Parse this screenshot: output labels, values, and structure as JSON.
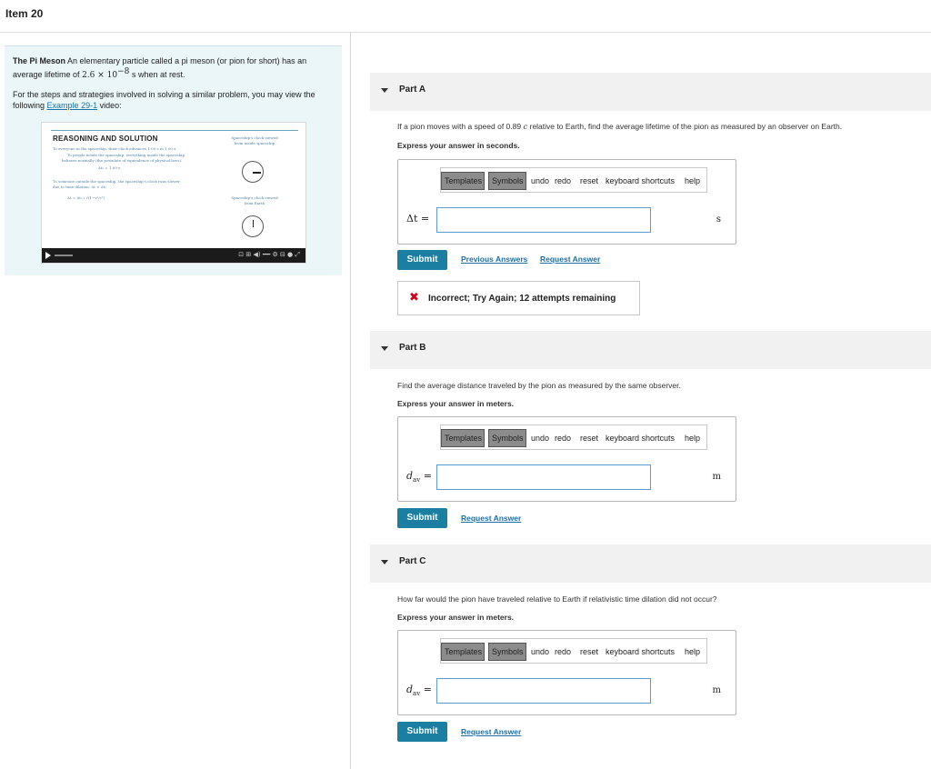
{
  "header": {
    "title": "Item 20"
  },
  "intro": {
    "title": "The Pi Meson",
    "text": "An elementary particle called a pi meson (or pion for short) has an average lifetime of",
    "value": "2.6 × 10",
    "exponent": "−8",
    "unit": "s",
    "tail": "when at rest.",
    "steps_text": "For the steps and strategies involved in solving a similar problem, you may view the following",
    "example_link": "Example 29-1",
    "steps_tail": "video:"
  },
  "video": {
    "heading": "REASONING AND SOLUTION",
    "line1": "To everyone in the spaceship, their clock advances 1.00 s in 1.00 s.",
    "line2": "To people inside the spaceship, everything inside the spaceship",
    "line3": "behaves normally (the postulate of equivalence of physical laws).",
    "line4": "Δt₀ = 1.00 s",
    "line5": "To someone outside the spaceship, the spaceship's clock runs slower",
    "line6": "due to time dilation: Δt > Δt₀",
    "line7": "Δt = Δt₀ / √(1−v²/c²)",
    "clock1_label": "Spaceship's clock viewed from inside spaceship",
    "clock2_label": "Spaceship's clock viewed from Earth",
    "controls": "⊡ ⊞ ◀) ━━ ⚙ ⊟ ● ⤢"
  },
  "toolbar": {
    "templates": "Templates",
    "symbols": "Symbols",
    "undo": "undo",
    "redo": "redo",
    "reset": "reset",
    "keyboard": "keyboard shortcuts",
    "help": "help"
  },
  "partA": {
    "label": "Part A",
    "question_pre": "If a pion moves with a speed of 0.89",
    "question_var": "c",
    "question_post": "relative to Earth, find the average lifetime of the pion as measured by an observer on Earth.",
    "express": "Express your answer in seconds.",
    "var": "Δt =",
    "unit": "s",
    "submit": "Submit",
    "previous": "Previous Answers",
    "request": "Request Answer",
    "feedback": "Incorrect; Try Again; 12 attempts remaining"
  },
  "partB": {
    "label": "Part B",
    "question": "Find the average distance traveled by the pion as measured by the same observer.",
    "express": "Express your answer in meters.",
    "var_main": "d",
    "var_sub": "av",
    "var_eq": "=",
    "unit": "m",
    "submit": "Submit",
    "request": "Request Answer"
  },
  "partC": {
    "label": "Part C",
    "question": "How far would the pion have traveled relative to Earth if relativistic time dilation did not occur?",
    "express": "Express your answer in meters.",
    "var_main": "d",
    "var_sub": "av",
    "var_eq": "=",
    "unit": "m",
    "submit": "Submit",
    "request": "Request Answer"
  }
}
